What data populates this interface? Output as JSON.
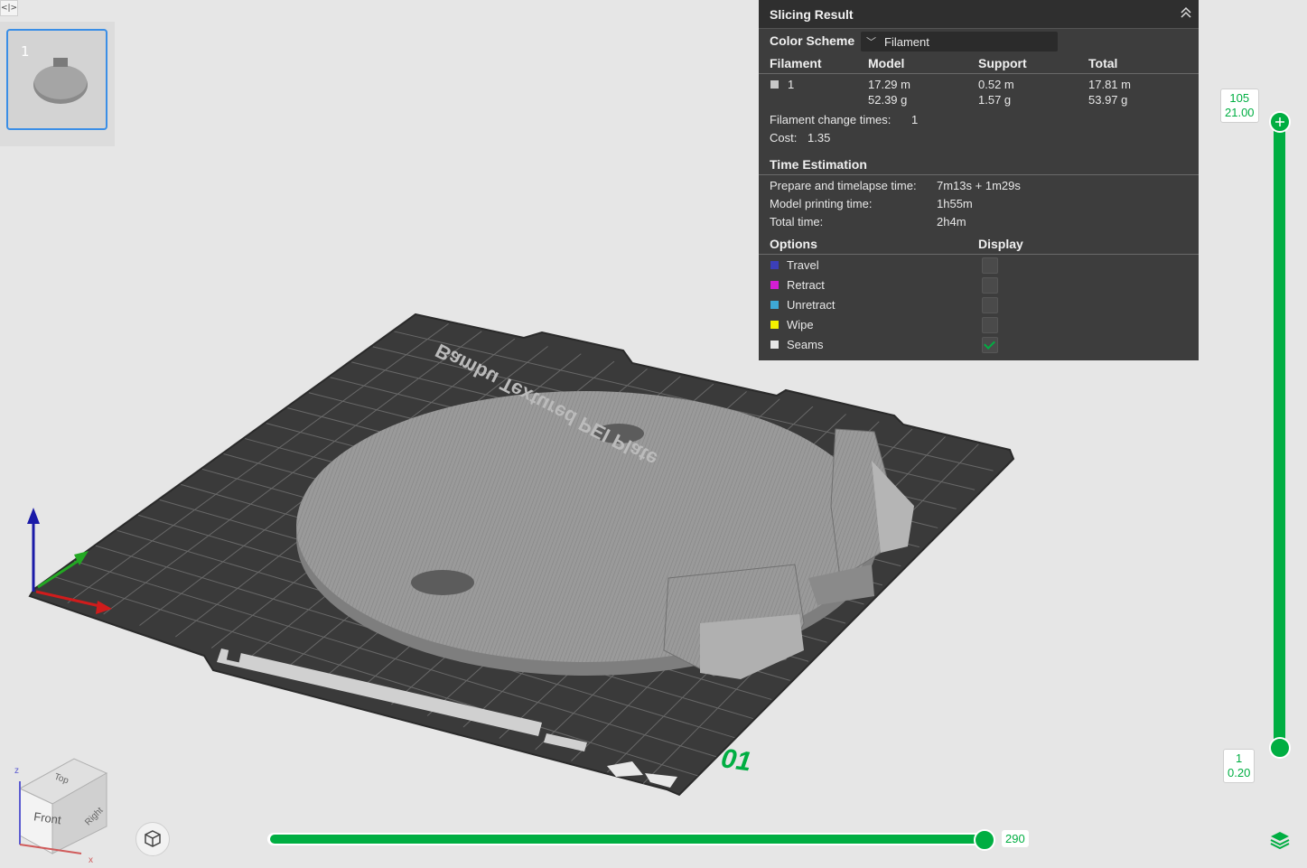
{
  "plate": {
    "number": "1",
    "label": "Bambu Textured PEI Plate",
    "plate_index": "01"
  },
  "slicing_result": {
    "title": "Slicing Result",
    "color_scheme_label": "Color Scheme",
    "color_scheme_value": "Filament",
    "filament_table": {
      "headers": [
        "Filament",
        "Model",
        "Support",
        "Total"
      ],
      "rows": [
        {
          "filament": "1",
          "model_length": "17.29 m",
          "model_weight": "52.39 g",
          "support_length": "0.52 m",
          "support_weight": "1.57 g",
          "total_length": "17.81 m",
          "total_weight": "53.97 g",
          "color": "#c8c8c8"
        }
      ]
    },
    "filament_change_label": "Filament change times:",
    "filament_change_value": "1",
    "cost_label": "Cost:",
    "cost_value": "1.35",
    "time_estimation": {
      "title": "Time Estimation",
      "rows": [
        {
          "label": "Prepare and timelapse time:",
          "value": "7m13s + 1m29s"
        },
        {
          "label": "Model printing time:",
          "value": "1h55m"
        },
        {
          "label": "Total time:",
          "value": "2h4m"
        }
      ]
    },
    "options": {
      "header_options": "Options",
      "header_display": "Display",
      "items": [
        {
          "label": "Travel",
          "color": "#3c3fb8",
          "checked": false
        },
        {
          "label": "Retract",
          "color": "#d31ed3",
          "checked": false
        },
        {
          "label": "Unretract",
          "color": "#3ea8d6",
          "checked": false
        },
        {
          "label": "Wipe",
          "color": "#f3f000",
          "checked": false
        },
        {
          "label": "Seams",
          "color": "#e8e8e8",
          "checked": true
        }
      ]
    }
  },
  "layer_slider": {
    "top_layer": "105",
    "top_height": "21.00",
    "bottom_layer": "1",
    "bottom_height": "0.20"
  },
  "move_slider": {
    "value": "290"
  },
  "view_cube": {
    "top": "Top",
    "front": "Front",
    "right": "Right",
    "axis_z": "z",
    "axis_x": "x"
  },
  "colors": {
    "accent": "#00ae42",
    "panel_bg": "#3d3d3d",
    "plate": "#3b3b3b"
  }
}
